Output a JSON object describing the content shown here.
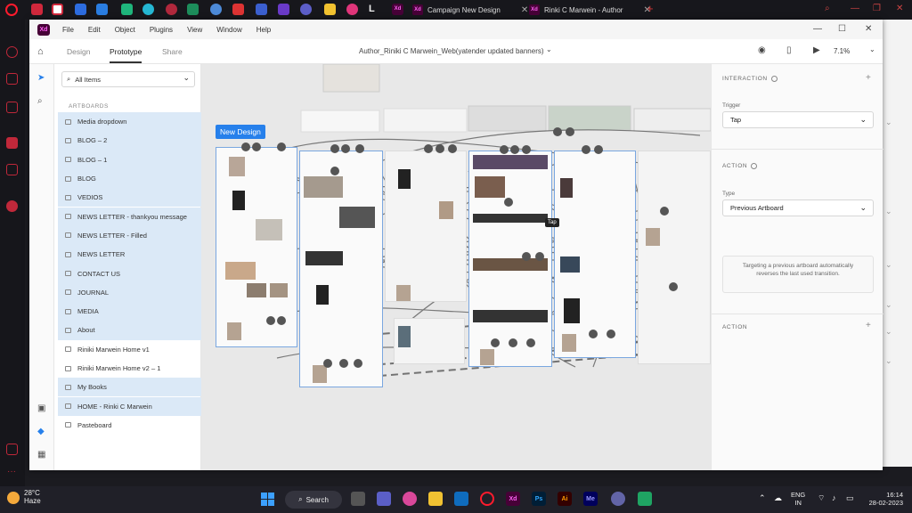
{
  "browser": {
    "tabs": [
      {
        "label": "Campaign New Design",
        "app": "Xd"
      },
      {
        "label": "Rinki C Marwein - Author",
        "app": "Xd"
      }
    ]
  },
  "xd": {
    "menu": [
      "File",
      "Edit",
      "Object",
      "Plugins",
      "View",
      "Window",
      "Help"
    ],
    "modes": [
      "Design",
      "Prototype",
      "Share"
    ],
    "active_mode": "Prototype",
    "doc_title": "Author_Riniki C Marwein_Web(yatender updated banners)",
    "zoom": "7.1%"
  },
  "layers": {
    "search_label": "All Items",
    "section": "ARTBOARDS",
    "items": [
      {
        "label": "Media dropdown",
        "selected": true
      },
      {
        "label": "BLOG – 2",
        "selected": true
      },
      {
        "label": "BLOG – 1",
        "selected": true
      },
      {
        "label": "BLOG",
        "selected": true
      },
      {
        "label": "VEDIOS",
        "selected": true
      },
      {
        "label": "NEWS LETTER - thankyou message",
        "selected": true
      },
      {
        "label": "NEWS LETTER - Filled",
        "selected": true
      },
      {
        "label": "NEWS LETTER",
        "selected": true
      },
      {
        "label": "CONTACT US",
        "selected": true
      },
      {
        "label": "JOURNAL",
        "selected": true
      },
      {
        "label": "MEDIA",
        "selected": true
      },
      {
        "label": "About",
        "selected": true
      },
      {
        "label": "Riniki Marwein Home v1",
        "selected": false
      },
      {
        "label": "Riniki Marwein Home v2 – 1",
        "selected": false
      },
      {
        "label": "My Books",
        "selected": true
      },
      {
        "label": "HOME - Rinki C Marwein",
        "selected": true
      },
      {
        "label": "Pasteboard",
        "selected": false
      }
    ]
  },
  "canvas": {
    "artboard_label": "New Design",
    "tap_label": "Tap"
  },
  "inspector": {
    "interaction_title": "INTERACTION",
    "trigger_label": "Trigger",
    "trigger_value": "Tap",
    "action_title": "ACTION",
    "type_label": "Type",
    "type_value": "Previous Artboard",
    "hint": "Targeting a previous artboard automatically reverses the last used transition.",
    "action2_title": "ACTION"
  },
  "taskbar": {
    "temp": "28°C",
    "weather": "Haze",
    "search": "Search",
    "lang1": "ENG",
    "lang2": "IN",
    "time": "16:14",
    "date": "28-02-2023"
  }
}
